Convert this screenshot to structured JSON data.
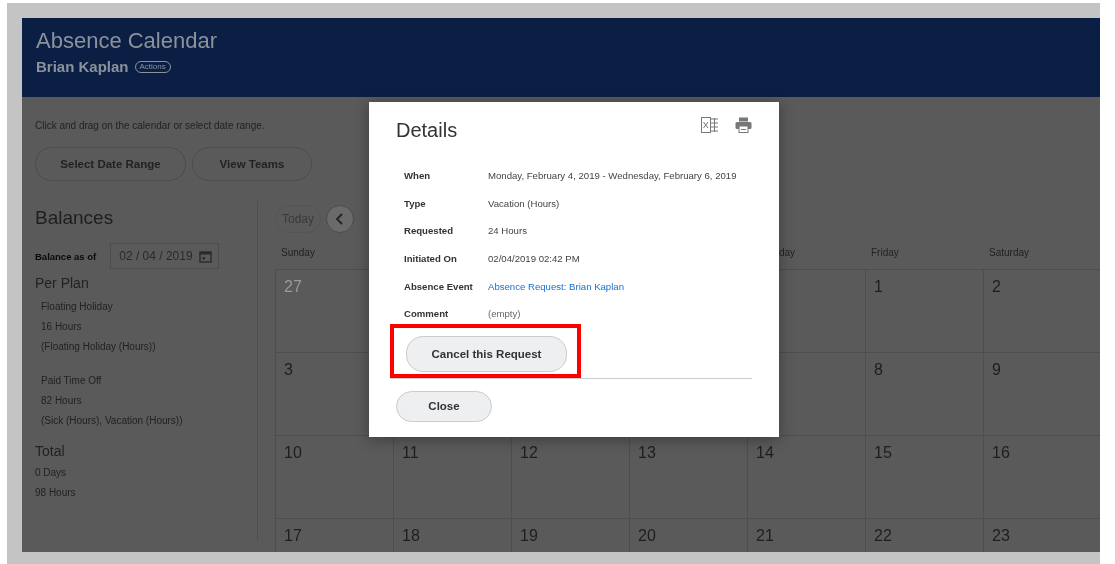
{
  "header": {
    "title": "Absence Calendar",
    "subtitle": "Brian Kaplan",
    "actions": "Actions"
  },
  "instruction": "Click and drag on the calendar or select date range.",
  "buttons": [
    "Select Date Range",
    "View Teams"
  ],
  "balances": {
    "title": "Balances",
    "as_of_label": "Balance as of",
    "as_of_value": "02 / 04 / 2019",
    "per_plan": "Per Plan",
    "plans": [
      {
        "name": "Floating Holiday",
        "amount": "16 Hours",
        "types": "(Floating Holiday (Hours))"
      },
      {
        "name": "Paid Time Off",
        "amount": "82 Hours",
        "types": "(Sick (Hours), Vacation (Hours))"
      }
    ],
    "total": "Total",
    "totals": [
      "0 Days",
      "98 Hours"
    ]
  },
  "calendar": {
    "today": "Today",
    "weekdays": [
      "Sunday",
      "day",
      "Friday",
      "Saturday"
    ],
    "weeks": [
      [
        {
          "day": "27",
          "muted": true
        },
        {
          "day": "1",
          "muted": false
        },
        {
          "day": "2",
          "muted": false
        }
      ],
      [
        {
          "day": "3",
          "muted": false
        },
        {
          "day": "8",
          "muted": false
        },
        {
          "day": "9",
          "muted": false
        }
      ],
      [
        {
          "day": "10",
          "muted": false
        },
        {
          "day": "11",
          "muted": false
        },
        {
          "day": "12",
          "muted": false
        },
        {
          "day": "13",
          "muted": false
        },
        {
          "day": "14",
          "muted": false
        },
        {
          "day": "15",
          "muted": false
        },
        {
          "day": "16",
          "muted": false
        }
      ],
      [
        {
          "day": "17",
          "muted": false
        },
        {
          "day": "18",
          "muted": false
        },
        {
          "day": "19",
          "muted": false
        },
        {
          "day": "20",
          "muted": false
        },
        {
          "day": "21",
          "muted": false
        },
        {
          "day": "22",
          "muted": false
        },
        {
          "day": "23",
          "muted": false
        }
      ]
    ]
  },
  "dialog": {
    "title": "Details",
    "fields": [
      {
        "label": "When",
        "value": "Monday, February 4, 2019 - Wednesday, February 6, 2019",
        "kind": "text"
      },
      {
        "label": "Type",
        "value": "Vacation (Hours)",
        "kind": "text"
      },
      {
        "label": "Requested",
        "value": "24 Hours",
        "kind": "text"
      },
      {
        "label": "Initiated On",
        "value": "02/04/2019 02:42 PM",
        "kind": "text"
      },
      {
        "label": "Absence Event",
        "value": "Absence Request: Brian Kaplan",
        "kind": "link"
      },
      {
        "label": "Comment",
        "value": "(empty)",
        "kind": "empty"
      }
    ],
    "action": "Cancel this Request",
    "highlighted": true,
    "close": "Close"
  }
}
